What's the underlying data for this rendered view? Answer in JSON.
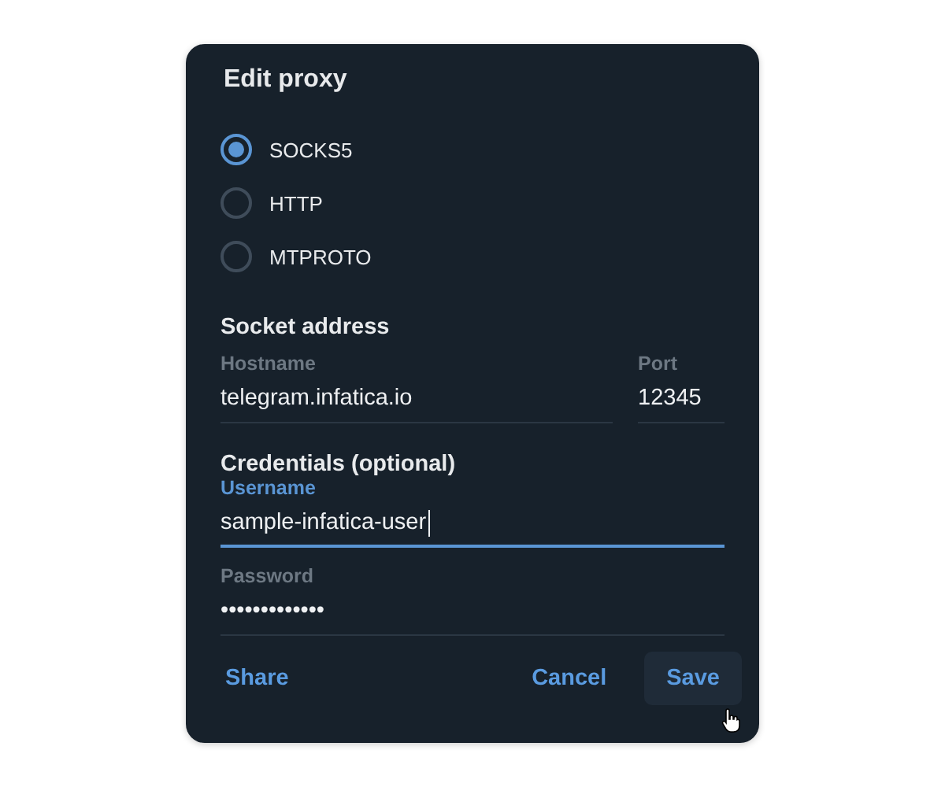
{
  "dialog": {
    "title": "Edit proxy",
    "proxy_types": [
      {
        "label": "SOCKS5",
        "selected": true
      },
      {
        "label": "HTTP",
        "selected": false
      },
      {
        "label": "MTPROTO",
        "selected": false
      }
    ],
    "socket_section": {
      "heading": "Socket address",
      "fields": [
        {
          "label": "Hostname",
          "value": "telegram.infatica.io",
          "focused": false
        },
        {
          "label": "Port",
          "value": "12345",
          "focused": false
        }
      ]
    },
    "credentials_section": {
      "heading": "Credentials (optional)",
      "fields": [
        {
          "label": "Username",
          "value": "sample-infatica-user",
          "focused": true
        },
        {
          "label": "Password",
          "value": "•••••••••••••",
          "focused": false
        }
      ]
    },
    "buttons": [
      {
        "label": "Share",
        "hovered": false
      },
      {
        "label": "Cancel",
        "hovered": false
      },
      {
        "label": "Save",
        "hovered": true
      }
    ]
  }
}
